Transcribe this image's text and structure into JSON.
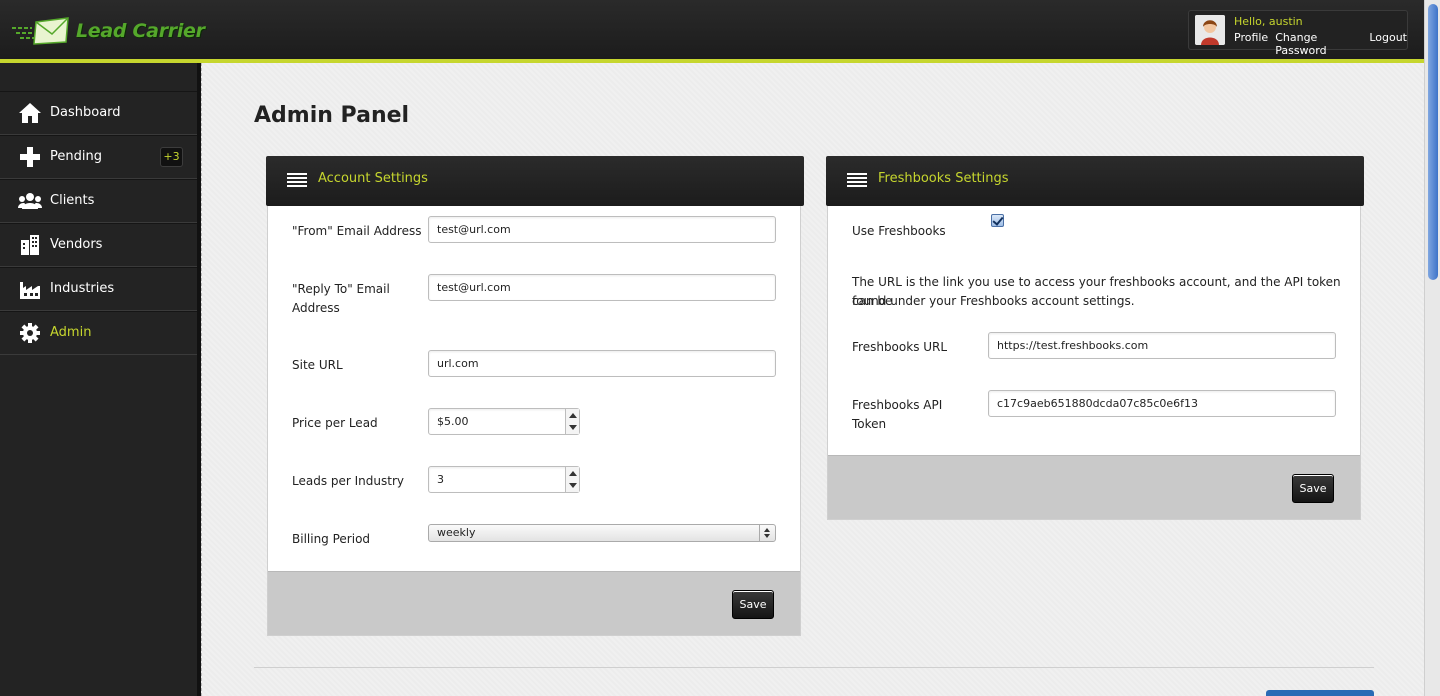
{
  "app": {
    "brand": "Lead Carrier"
  },
  "colors": {
    "accent": "#c6d62e",
    "dark": "#1c1c1c",
    "logo_green": "#55a82b"
  },
  "user": {
    "greeting": "Hello, austin",
    "links": [
      "Profile",
      "Change Password",
      "Logout"
    ]
  },
  "sidebar": {
    "items": [
      {
        "label": "Dashboard",
        "icon": "home-icon"
      },
      {
        "label": "Pending",
        "icon": "plus-icon",
        "badge": "+3"
      },
      {
        "label": "Clients",
        "icon": "users-icon"
      },
      {
        "label": "Vendors",
        "icon": "building-icon"
      },
      {
        "label": "Industries",
        "icon": "factory-icon"
      },
      {
        "label": "Admin",
        "icon": "gear-icon",
        "active": true
      }
    ]
  },
  "page": {
    "title": "Admin Panel"
  },
  "account": {
    "title": "Account Settings",
    "from_label": "\"From\" Email Address",
    "from_value": "test@url.com",
    "reply_label_1": "\"Reply To\" Email",
    "reply_label_2": "Address",
    "reply_value": "test@url.com",
    "site_label": "Site URL",
    "site_value": "url.com",
    "price_label": "Price per Lead",
    "price_value": "$5.00",
    "leads_label": "Leads per Industry",
    "leads_value": "3",
    "billing_label": "Billing Period",
    "billing_value": "weekly",
    "save_label": "Save"
  },
  "freshbooks": {
    "title": "Freshbooks Settings",
    "use_label": "Use Freshbooks",
    "use_checked": true,
    "help_1": "The URL is the link you use to access your freshbooks account, and the API token can be",
    "help_2": "found under your Freshbooks account settings.",
    "url_label": "Freshbooks URL",
    "url_value": "https://test.freshbooks.com",
    "token_label_1": "Freshbooks API",
    "token_label_2": "Token",
    "token_value": "c17c9aeb651880dcda07c85c0e6f13",
    "save_label": "Save"
  }
}
